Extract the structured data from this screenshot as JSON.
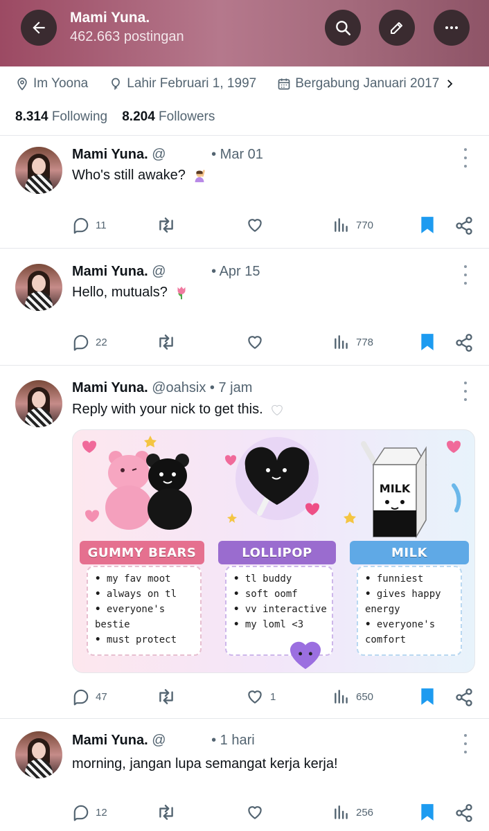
{
  "header": {
    "title": "Mami Yuna.",
    "posts_count": "462.663 postingan"
  },
  "profile": {
    "location": "Im Yoona",
    "birthday": "Lahir Februari 1, 1997",
    "joined": "Bergabung Januari 2017",
    "following_count": "8.314",
    "following_label": "Following",
    "followers_count": "8.204",
    "followers_label": "Followers"
  },
  "tweets": [
    {
      "name": "Mami Yuna.",
      "handle": "@",
      "time": "• Mar 01",
      "text": "Who's still awake?",
      "emoji": "person-raising-hand",
      "replies": "11",
      "likes": "",
      "views": "770"
    },
    {
      "name": "Mami Yuna.",
      "handle": "@",
      "time": "• Apr 15",
      "text": "Hello, mutuals?",
      "emoji": "tulip",
      "replies": "22",
      "likes": "",
      "views": "778"
    },
    {
      "name": "Mami Yuna.",
      "handle": "@oahsix",
      "time": "• 7 jam",
      "text": "Reply with your nick to get this.",
      "emoji": "white-heart",
      "replies": "47",
      "likes": "1",
      "views": "650"
    },
    {
      "name": "Mami Yuna.",
      "handle": "@",
      "time": "• 1 hari",
      "text": "morning, jangan lupa semangat kerja kerja!",
      "emoji": "",
      "replies": "12",
      "likes": "",
      "views": "256"
    }
  ],
  "media": {
    "panels": [
      {
        "title": "GUMMY BEARS",
        "items": [
          "my fav moot",
          "always on tl",
          "everyone's",
          "bestie",
          "must protect"
        ]
      },
      {
        "title": "LOLLIPOP",
        "items": [
          "tl buddy",
          "soft oomf",
          "vv interactive",
          "my loml <3"
        ]
      },
      {
        "title": "MILK",
        "carton_label": "MILK",
        "items": [
          "funniest",
          "gives happy",
          "energy",
          "everyone's",
          "comfort"
        ]
      }
    ]
  },
  "colors": {
    "header_bg": "#a56b7d",
    "text_secondary": "#536471",
    "bookmark_blue": "#1d9bf0"
  }
}
